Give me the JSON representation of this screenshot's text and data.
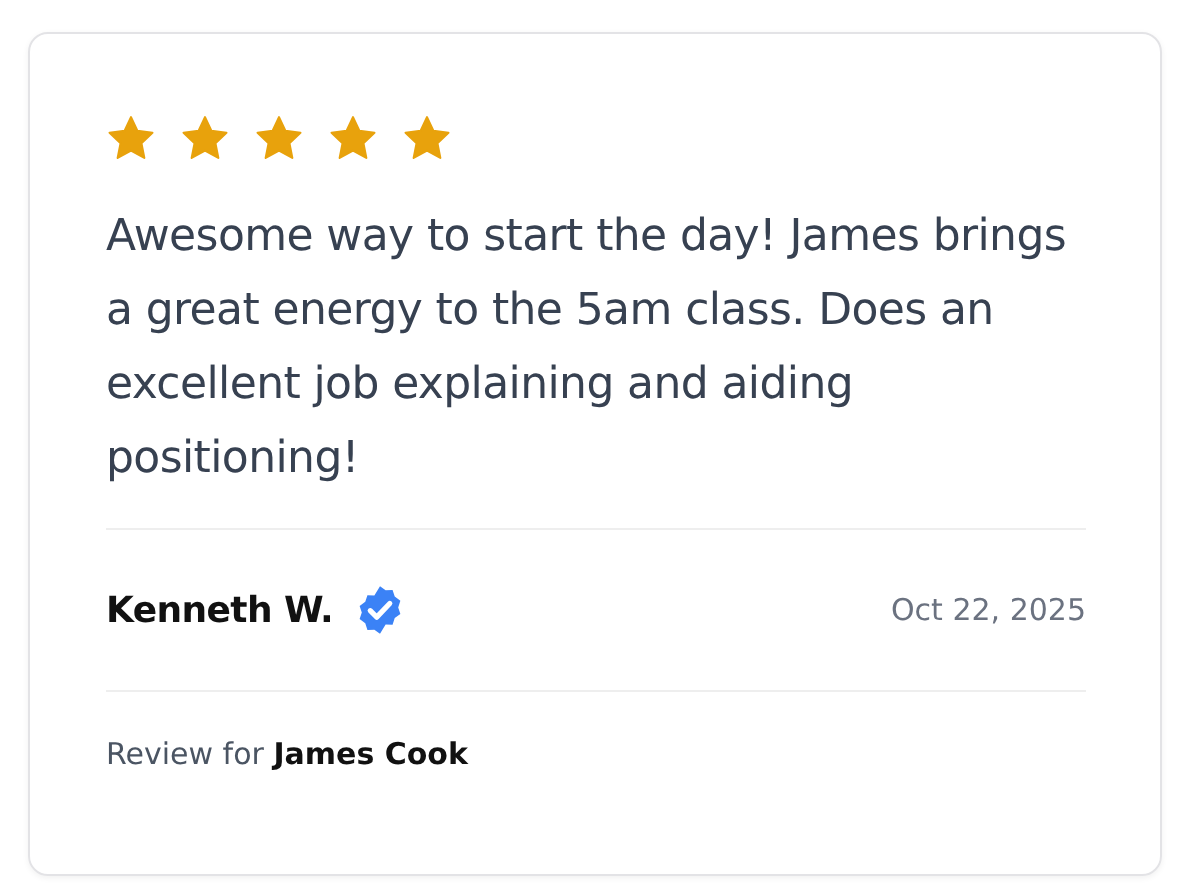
{
  "review": {
    "stars": 5,
    "text": "Awesome way to start the day! James brings a great energy to the 5am class. Does an excellent job explaining and aiding positioning!",
    "author": "Kenneth W.",
    "verified": true,
    "date": "Oct 22, 2025",
    "review_for": "Review for **James Cook**"
  }
}
